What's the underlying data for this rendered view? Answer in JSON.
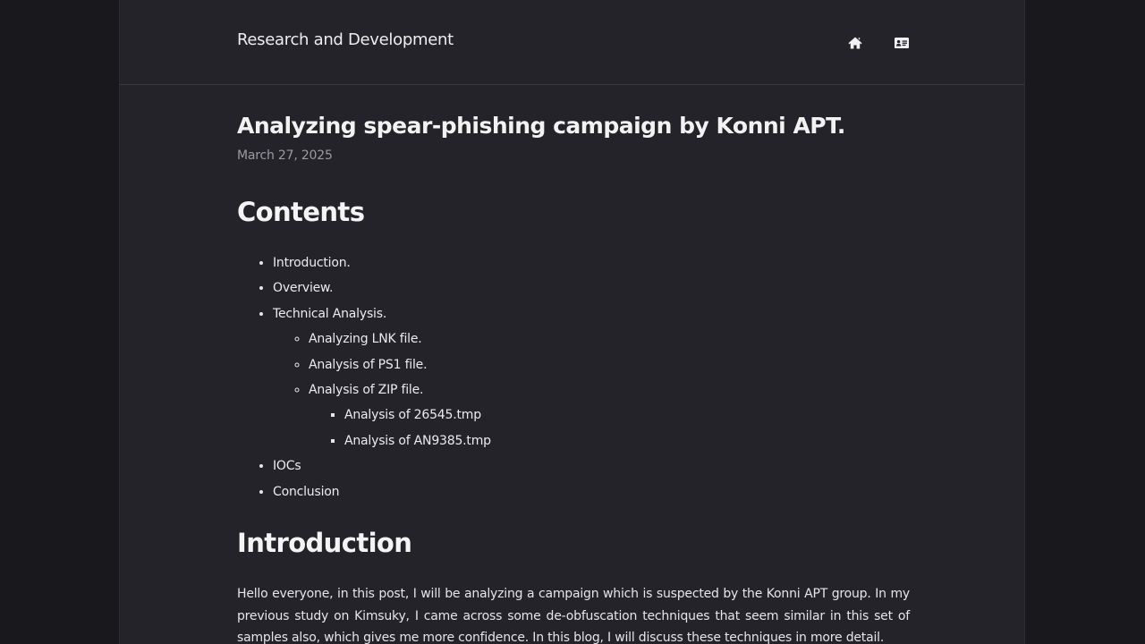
{
  "site": {
    "title": "Research and Development",
    "nav": [
      {
        "icon": "home-icon"
      },
      {
        "icon": "id-card-icon"
      }
    ]
  },
  "post": {
    "title": "Analyzing spear-phishing campaign by Konni APT.",
    "date": "March 27, 2025"
  },
  "contents": {
    "heading": "Contents",
    "items": [
      {
        "label": "Introduction."
      },
      {
        "label": "Overview."
      },
      {
        "label": "Technical Analysis.",
        "children": [
          {
            "label": "Analyzing LNK file."
          },
          {
            "label": "Analysis of PS1 file."
          },
          {
            "label": "Analysis of ZIP file.",
            "children": [
              {
                "label": "Analysis of 26545.tmp"
              },
              {
                "label": "Analysis of AN9385.tmp"
              }
            ]
          }
        ]
      },
      {
        "label": "IOCs"
      },
      {
        "label": "Conclusion"
      }
    ]
  },
  "introduction": {
    "heading": "Introduction",
    "paragraph": "Hello everyone, in this post, I will be analyzing a campaign which is suspected by the Konni APT group. In my previous study on Kimsuky, I came across some de-obfuscation techniques that seem similar in this set of samples also, which gives me more confidence. In this blog, I will discuss these techniques in more detail."
  },
  "colors": {
    "page_bg": "#19191d",
    "container_bg": "#232329",
    "text": "#e7e7e9",
    "muted": "#9a9aa1"
  }
}
